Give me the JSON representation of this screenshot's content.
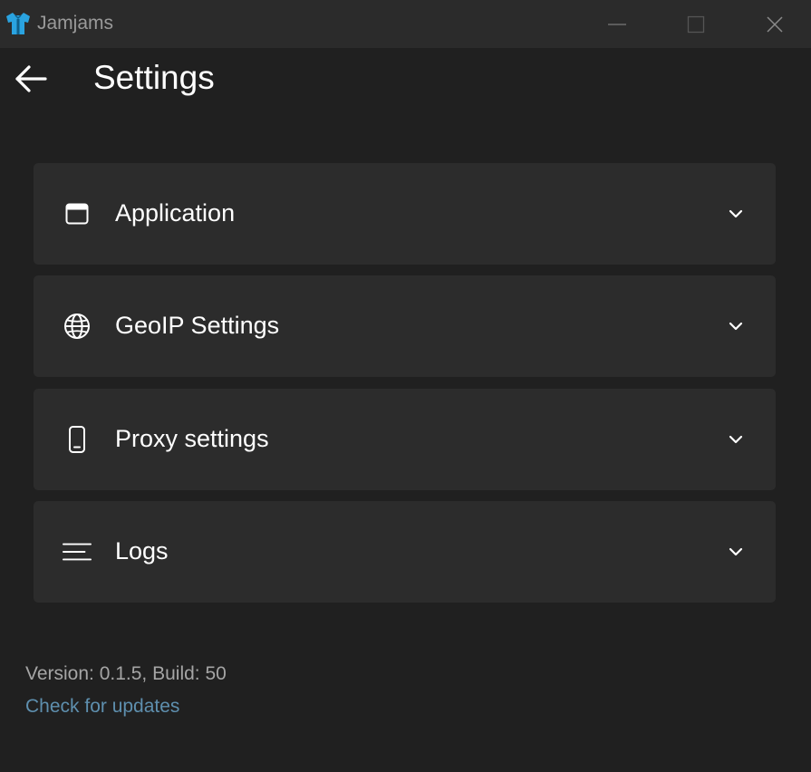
{
  "window": {
    "title": "Jamjams",
    "logo_icon": "shirt-logo-icon",
    "controls": [
      "minimize-icon",
      "maximize-icon",
      "close-icon"
    ]
  },
  "header": {
    "back_icon": "arrow-left-icon",
    "title": "Settings"
  },
  "sections": [
    {
      "label": "Application",
      "icon": "window-icon"
    },
    {
      "label": "GeoIP Settings",
      "icon": "globe-icon"
    },
    {
      "label": "Proxy settings",
      "icon": "phone-icon"
    },
    {
      "label": "Logs",
      "icon": "lines-icon"
    }
  ],
  "footer": {
    "version": "Version: 0.1.5, Build: 50",
    "update_link": "Check for updates"
  },
  "colors": {
    "background": "#202020",
    "titlebar": "#2b2b2b",
    "card": "#2c2c2c",
    "link": "#5e8fae",
    "logo": "#2aa3e0"
  }
}
